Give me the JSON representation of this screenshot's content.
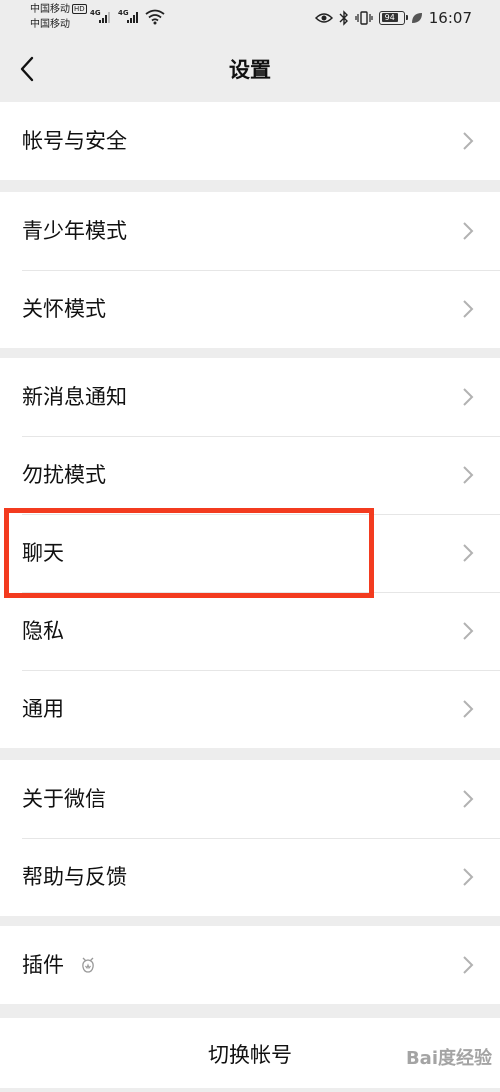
{
  "status_bar": {
    "carrier1": "中国移动",
    "carrier1_badge": "HD",
    "carrier2": "中国移动",
    "sim1_type": "4G",
    "sim2_type": "4G",
    "battery": "94",
    "time": "16:07",
    "icons": [
      "eye-icon",
      "bluetooth-icon",
      "vibrate-icon",
      "leaf-icon",
      "wifi-icon"
    ]
  },
  "nav": {
    "title": "设置",
    "back_icon": "chevron-left-icon"
  },
  "groups": [
    {
      "items": [
        {
          "label": "帐号与安全"
        }
      ]
    },
    {
      "items": [
        {
          "label": "青少年模式"
        },
        {
          "label": "关怀模式"
        }
      ]
    },
    {
      "items": [
        {
          "label": "新消息通知"
        },
        {
          "label": "勿扰模式"
        },
        {
          "label": "聊天"
        },
        {
          "label": "隐私"
        },
        {
          "label": "通用"
        }
      ]
    },
    {
      "items": [
        {
          "label": "关于微信"
        },
        {
          "label": "帮助与反馈"
        }
      ]
    },
    {
      "items": [
        {
          "label": "插件",
          "icon": "plugin-icon"
        }
      ]
    }
  ],
  "switch_account": "切换帐号",
  "highlighted_item": "聊天",
  "highlight_color": "#f33b1f",
  "watermark": "Bai度经验"
}
